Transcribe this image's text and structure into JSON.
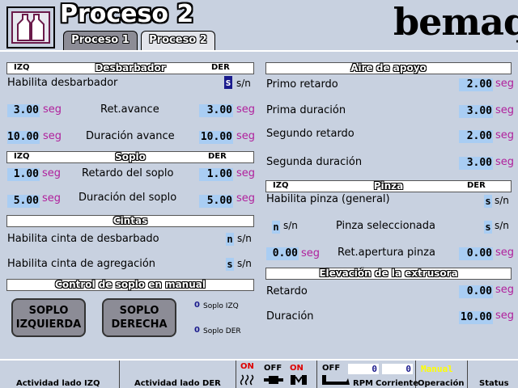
{
  "header": {
    "title": "Proceso 2",
    "brand": "bemaq",
    "tabs": [
      {
        "label": "Proceso 1"
      },
      {
        "label": "Proceso 2"
      }
    ]
  },
  "desbarbador": {
    "title": "Desbarbador",
    "izq": "IZQ",
    "der": "DER",
    "habilita_label": "Habilita desbarbador",
    "habilita_value": "s",
    "habilita_sn": "s/n",
    "retavance_label": "Ret.avance",
    "retavance_izq": "3.00",
    "retavance_der": "3.00",
    "duracion_label": "Duración avance",
    "duracion_izq": "10.00",
    "duracion_der": "10.00",
    "unit": "seg"
  },
  "soplo": {
    "title": "Soplo",
    "izq": "IZQ",
    "der": "DER",
    "retardo_label": "Retardo del soplo",
    "retardo_izq": "1.00",
    "retardo_der": "1.00",
    "duracion_label": "Duración del soplo",
    "duracion_izq": "5.00",
    "duracion_der": "5.00",
    "unit": "seg"
  },
  "cintas": {
    "title": "Cintas",
    "desbarbado_label": "Habilita cinta de desbarbado",
    "desbarbado_value": "n",
    "desbarbado_sn": "s/n",
    "agregacion_label": "Habilita cinta de agregación",
    "agregacion_value": "s",
    "agregacion_sn": "s/n"
  },
  "control_soplo": {
    "title": "Control de soplo en manual",
    "btn_izq_line1": "SOPLO",
    "btn_izq_line2": "IZQUIERDA",
    "btn_der_line1": "SOPLO",
    "btn_der_line2": "DERECHA",
    "soplo_izq_value": "0",
    "soplo_izq_label": "Soplo IZQ",
    "soplo_der_value": "0",
    "soplo_der_label": "Soplo DER"
  },
  "aire": {
    "title": "Aire de apoyo",
    "primo_retardo_label": "Primo retardo",
    "primo_retardo": "2.00",
    "prima_duracion_label": "Prima duración",
    "prima_duracion": "3.00",
    "segundo_retardo_label": "Segundo retardo",
    "segundo_retardo": "2.00",
    "segunda_duracion_label": "Segunda duración",
    "segunda_duracion": "3.00",
    "unit": "seg"
  },
  "pinza": {
    "title": "Pinza",
    "izq": "IZQ",
    "der": "DER",
    "habilita_label": "Habilita pinza (general)",
    "habilita_value": "s",
    "habilita_sn": "s/n",
    "sel_izq_value": "n",
    "sel_izq_sn": "s/n",
    "seleccionada_label": "Pinza seleccionada",
    "sel_der_value": "s",
    "sel_der_sn": "s/n",
    "retapertura_label": "Ret.apertura pinza",
    "retapertura_izq": "0.00",
    "retapertura_der": "0.00",
    "unit": "seg"
  },
  "elevacion": {
    "title": "Elevación de la extrusora",
    "retardo_label": "Retardo",
    "retardo": "0.00",
    "duracion_label": "Duración",
    "duracion": "10.00",
    "unit": "seg"
  },
  "bottom": {
    "actividad_izq": "Actividad lado IZQ",
    "actividad_der": "Actividad lado DER",
    "on1": "ON",
    "off1": "OFF",
    "on2": "ON",
    "off2": "OFF",
    "rpm1": "0",
    "rpm2": "0",
    "rpm_label": "RPM",
    "corriente_label": "Corriente",
    "mode": "Manual",
    "operacion_label": "Operación",
    "status_label": "Status",
    "colors": {
      "on": "#dd0000",
      "manual": "#ffff00",
      "field": "#a9cdf3"
    }
  }
}
